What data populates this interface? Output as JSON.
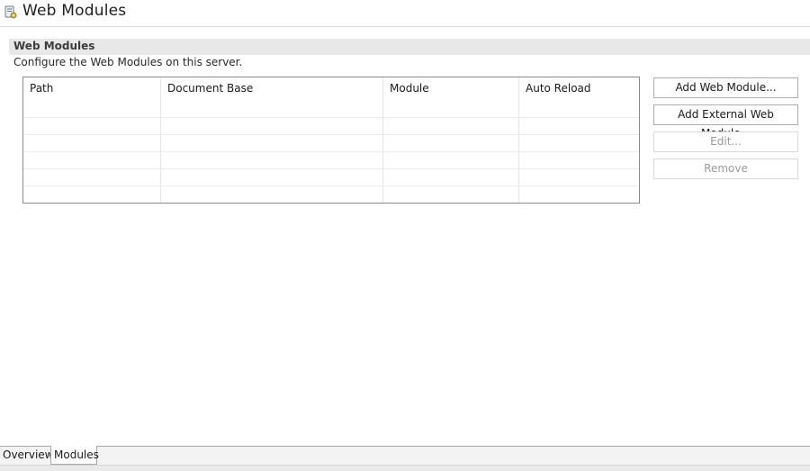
{
  "header": {
    "title": "Web Modules",
    "icon": "server-config-icon"
  },
  "section": {
    "title": "Web Modules",
    "description": "Configure the Web Modules on this server."
  },
  "table": {
    "columns": [
      "Path",
      "Document Base",
      "Module",
      "Auto Reload"
    ],
    "rows": []
  },
  "buttons": {
    "add_web_module": "Add Web Module...",
    "add_external_web_module": "Add External Web Module...",
    "edit": "Edit...",
    "remove": "Remove"
  },
  "tabs": [
    {
      "label": "Overview",
      "active": false
    },
    {
      "label": "Modules",
      "active": true
    }
  ],
  "colors": {
    "section_bar": "#e8e8e8",
    "table_border": "#8c8c8c",
    "disabled_text": "#9a9a9a"
  }
}
